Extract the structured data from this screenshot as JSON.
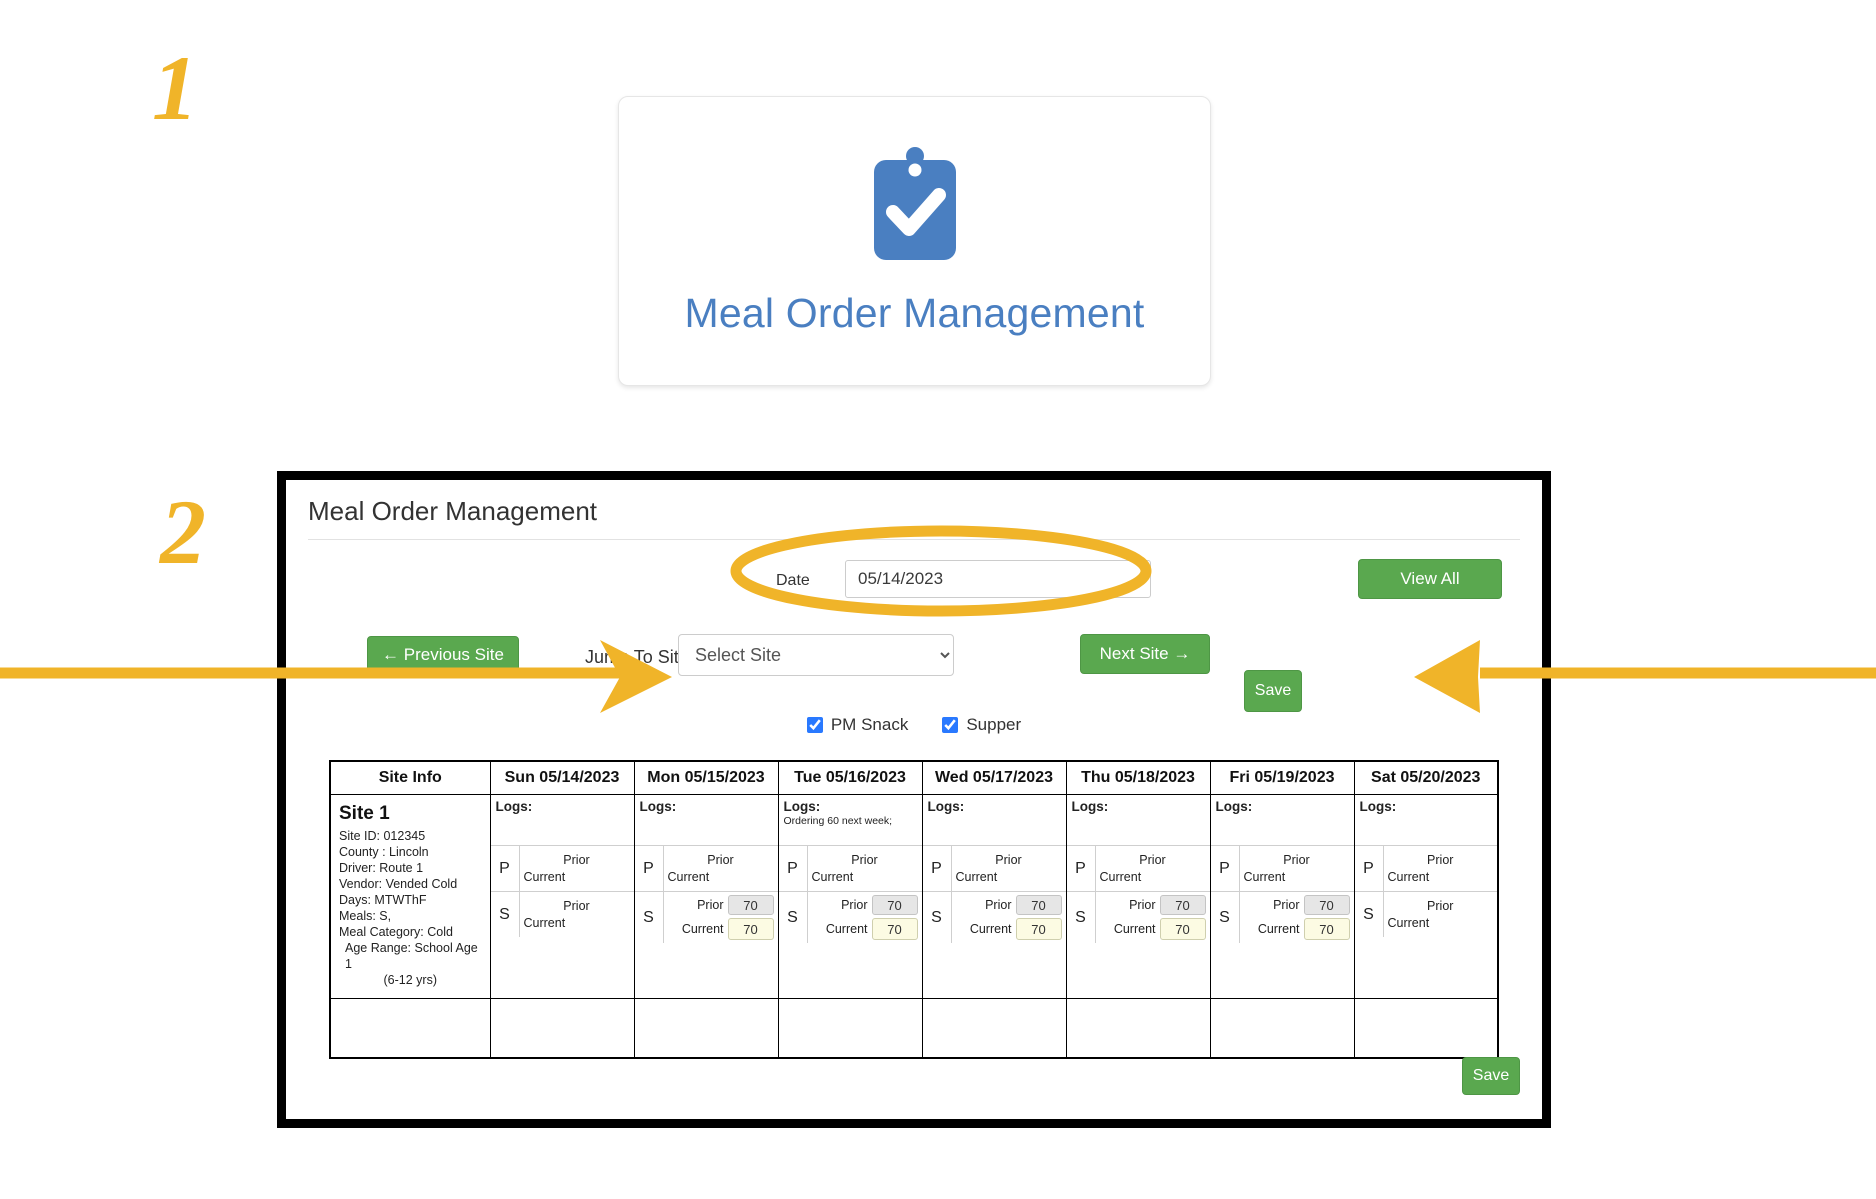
{
  "markers": {
    "one": "1",
    "two": "2"
  },
  "tile": {
    "label": "Meal Order Management",
    "icon": "clipboard-check-icon",
    "icon_color": "#4a7fc1",
    "label_color": "#4a7fc1"
  },
  "panel": {
    "title": "Meal Order Management",
    "date": {
      "label": "Date",
      "value": "05/14/2023"
    },
    "view_all_label": "View All",
    "previous_site_label": "← Previous Site",
    "next_site_label": "Next Site →",
    "jump_label": "Jump To Site:",
    "jump_value": "Select Site",
    "save_label_top": "Save",
    "save_label_bottom": "Save",
    "accent_green": "#5aa84f",
    "annotation_color": "#f0b429"
  },
  "meal_filters": [
    {
      "label": "PM Snack",
      "checked": true
    },
    {
      "label": "Supper",
      "checked": true
    }
  ],
  "table": {
    "headers": [
      "Site Info",
      "Sun 05/14/2023",
      "Mon 05/15/2023",
      "Tue 05/16/2023",
      "Wed 05/17/2023",
      "Thu 05/18/2023",
      "Fri 05/19/2023",
      "Sat 05/20/2023"
    ],
    "site_info": {
      "name": "Site 1",
      "lines": [
        "Site ID: 012345",
        "County : Lincoln",
        "Driver: Route 1",
        "Vendor: Vended Cold",
        "Days: MTWThF",
        "Meals: S,",
        "Meal Category: Cold"
      ],
      "age_range": "Age Range: School Age 1",
      "age_range_detail": "(6-12 yrs)"
    },
    "logs_label": "Logs:",
    "prior_label": "Prior",
    "current_label": "Current",
    "meal_codes": {
      "p": "P",
      "s": "S"
    },
    "days": [
      {
        "key": "sun",
        "log_note": "",
        "p_prior": "",
        "p_current": "",
        "s_prior": "",
        "s_current": ""
      },
      {
        "key": "mon",
        "log_note": "",
        "p_prior": "",
        "p_current": "",
        "s_prior": "70",
        "s_current": "70"
      },
      {
        "key": "tue",
        "log_note": "Ordering 60 next week;",
        "p_prior": "",
        "p_current": "",
        "s_prior": "70",
        "s_current": "70"
      },
      {
        "key": "wed",
        "log_note": "",
        "p_prior": "",
        "p_current": "",
        "s_prior": "70",
        "s_current": "70"
      },
      {
        "key": "thu",
        "log_note": "",
        "p_prior": "",
        "p_current": "",
        "s_prior": "70",
        "s_current": "70"
      },
      {
        "key": "fri",
        "log_note": "",
        "p_prior": "",
        "p_current": "",
        "s_prior": "70",
        "s_current": "70"
      },
      {
        "key": "sat",
        "log_note": "",
        "p_prior": "",
        "p_current": "",
        "s_prior": "",
        "s_current": ""
      }
    ]
  }
}
